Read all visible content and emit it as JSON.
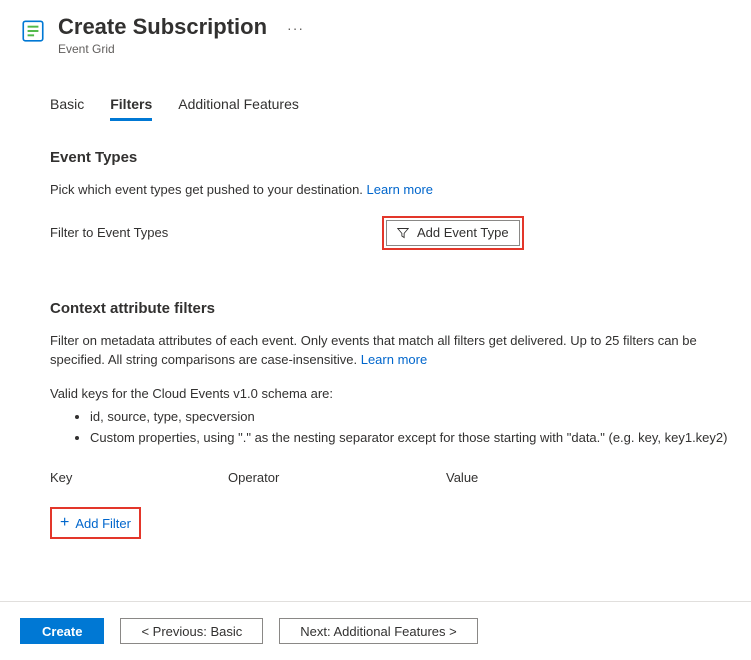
{
  "header": {
    "title": "Create Subscription",
    "subtitle": "Event Grid"
  },
  "tabs": {
    "basic": "Basic",
    "filters": "Filters",
    "additional": "Additional Features"
  },
  "eventTypes": {
    "heading": "Event Types",
    "description": "Pick which event types get pushed to your destination.",
    "learnMore": "Learn more",
    "filterLabel": "Filter to Event Types",
    "addButton": "Add Event Type"
  },
  "contextFilters": {
    "heading": "Context attribute filters",
    "desc1": "Filter on metadata attributes of each event. Only events that match all filters get delivered. Up to 25 filters can be specified. All string comparisons are case-insensitive.",
    "learnMore": "Learn more",
    "validKeysIntro": "Valid keys for the Cloud Events v1.0 schema are:",
    "bullet1": "id, source, type, specversion",
    "bullet2": "Custom properties, using \".\" as the nesting separator except for those starting with \"data.\" (e.g. key, key1.key2)",
    "colKey": "Key",
    "colOperator": "Operator",
    "colValue": "Value",
    "addFilter": "Add Filter"
  },
  "footer": {
    "create": "Create",
    "prev": "< Previous: Basic",
    "next": "Next: Additional Features >"
  }
}
